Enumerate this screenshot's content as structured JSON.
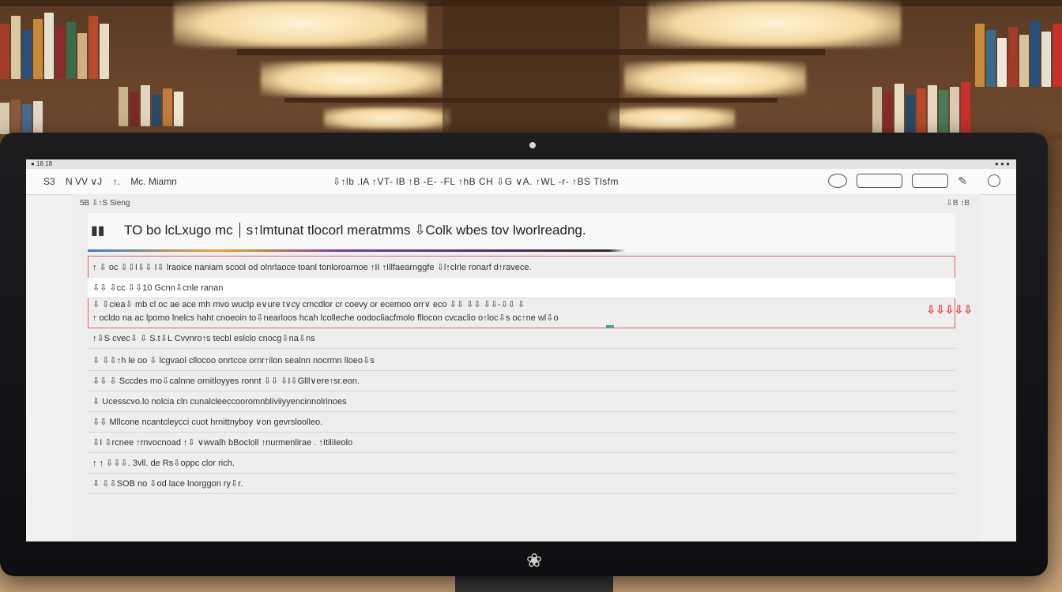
{
  "menubar": {
    "left": "● 18 18",
    "right": "● ● ●"
  },
  "toolbar": {
    "left_items": [
      "S3",
      "N VV ∨J",
      "↑.",
      "Mc. Miamn"
    ],
    "center_text": "⇩↑lb .lA ↑VT- lB ↑B -E- -FL ↑hB CH ⇩G ∨A. ↑WL -r- ↑BS Tlsfm",
    "right_icons": [
      "display-icon",
      "window-icon",
      "layout-icon",
      "pen-icon",
      "clock-icon"
    ]
  },
  "doc": {
    "header_left": "5B ⇩↑S Sieng",
    "header_right": "⇩B ↑B",
    "title_icon": "▮▮",
    "title_left": "TO bo lcLxugo mc",
    "title_right": "s↑lmtunat tlocorl meratmms ⇩Colk  wbes tov lworlreadng.",
    "highlighted_row": "↑ ⇩ oc ⇩⇩I⇩⇩ I⇩ lraoice naniam scool od olnrlaoce toanl tonloroarnoe ↑II ↑Illfaearnggfe ⇩l↑clrle ronarf d↑ravece.",
    "section_label": "⇩⇩ ⇩cc ⇩⇩10 Gcnn⇩cnle ranan",
    "multi_line_1": "⇩ ⇩ciea⇩ mb cl oc ae ace mh mvo wuclp e∨ure t∨cy cmcdlor cr coevy or ecemoo orr∨ eco  ⇩⇩ ⇩⇩ ⇩⇩-⇩⇩ ⇩",
    "multi_line_2": "↑ ocldo na ac lpomo lnelcs haht cnoeoin to⇩nearloos hcah lcolleche  oodocliacfmolo fllocon cvcaclio o↑loc⇩s oc↑ne wl⇩o",
    "red_tag": "⇩⇩⇩⇩⇩",
    "rows": [
      "↑⇩S cvec⇩ ⇩ S.t⇩L Cvvnro↑s tecbl eslclo cnocg⇩na⇩ns",
      "⇩ ⇩⇩↑h le oo ⇩ lcgvaol cllocoo onrtcce ornr↑ilon sealnn nocrmn lloeo⇩s",
      "⇩⇩ ⇩ Sccdes mo⇩calnne ornitloyyes ronnt  ⇩⇩  ⇩I⇩Glll∨ere↑sr.eon.",
      "⇩ Ucesscvo.lo nolcia cln cunalcleeccooromnbliviiyyencinnolrinoes",
      "⇩⇩ Mllcone ncantcleycci cuot hrnittnyboy ∨on gevrsloolleo.",
      "⇩I ⇩rcnee ↑rnvocnoad ↑⇩ ∨wvalh bBocloll ↑nurmenlirae . ↑ItiliIeolo",
      "↑ ↑ ⇩⇩⇩. 3vll. de Rs⇩oppc clor rich.",
      "⇩ ⇩⇩SOB no ⇩od lace lnorggon ry⇩r."
    ]
  },
  "taskbar": {
    "buttons": [
      "⇩ ⇩",
      "⇩⇩",
      "⇩",
      "⇩⇩⇩⇩"
    ],
    "right": "⇩⇩⇩"
  }
}
